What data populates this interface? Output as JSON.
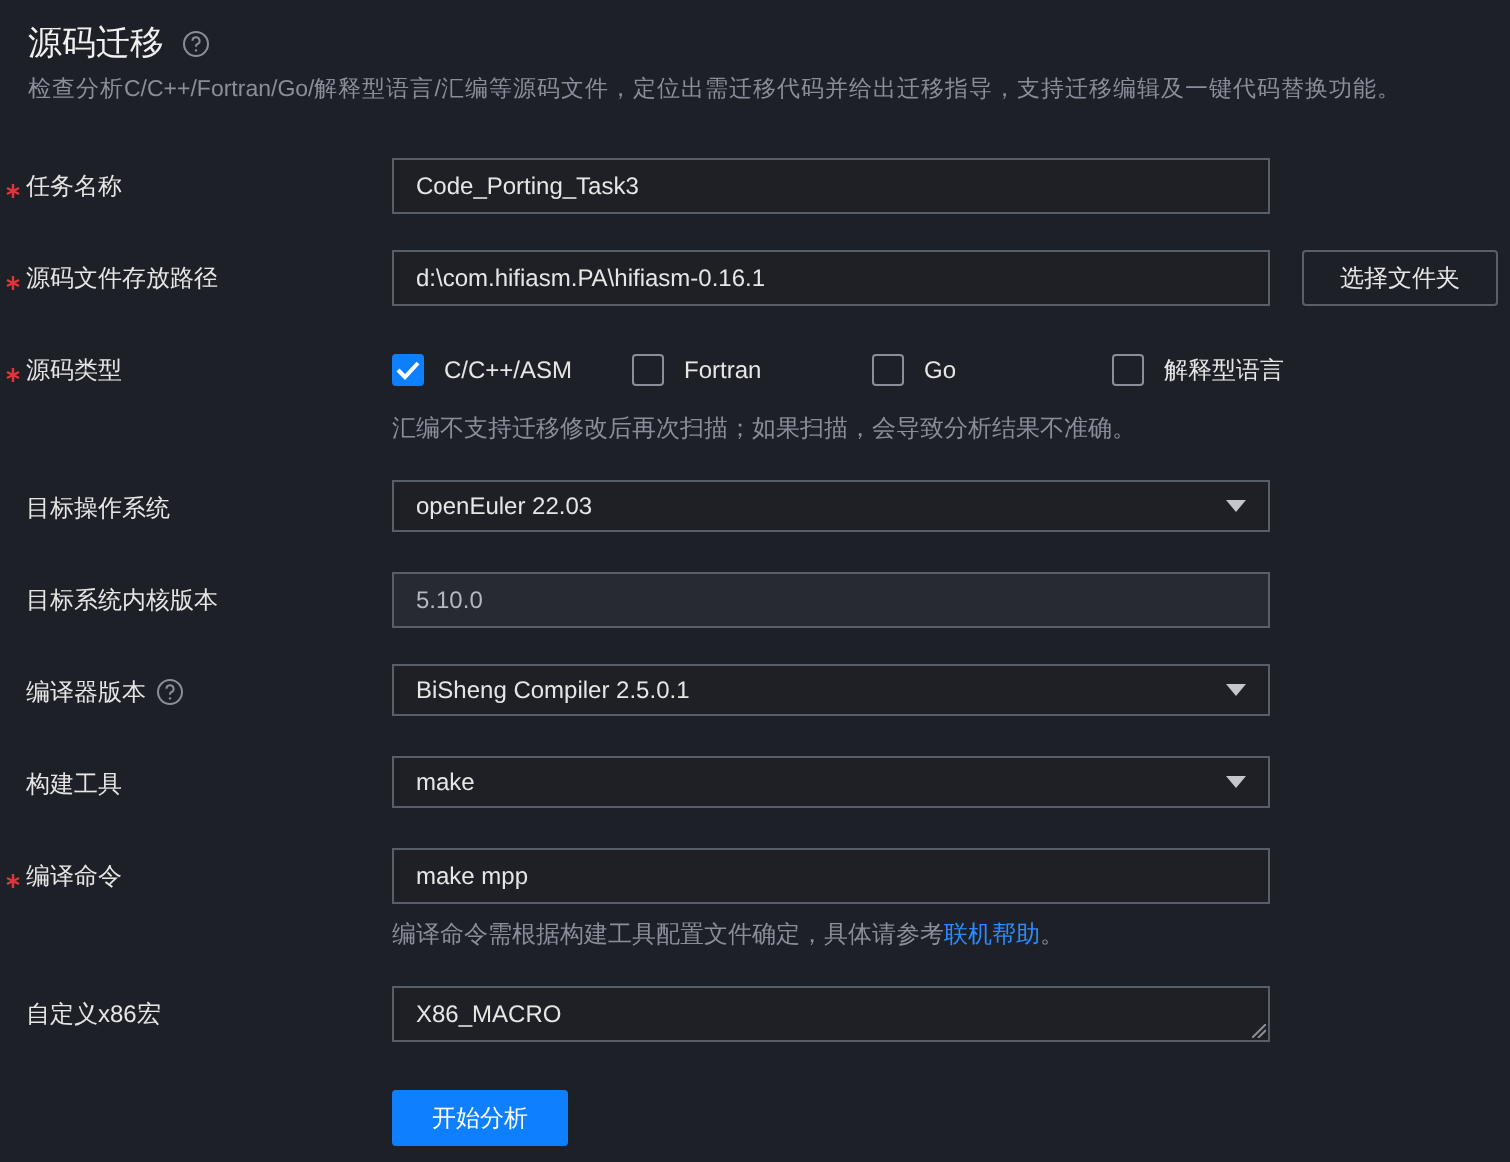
{
  "header": {
    "title": "源码迁移",
    "description": "检查分析C/C++/Fortran/Go/解释型语言/汇编等源码文件，定位出需迁移代码并给出迁移指导，支持迁移编辑及一键代码替换功能。"
  },
  "fields": [
    {
      "kind": "text",
      "label": "任务名称",
      "required": true,
      "value": "Code_Porting_Task3"
    },
    {
      "kind": "path",
      "label": "源码文件存放路径",
      "required": true,
      "value": "d:\\com.hifiasm.PA\\hifiasm-0.16.1",
      "button": "选择文件夹"
    },
    {
      "kind": "checkboxes",
      "label": "源码类型",
      "required": true,
      "options": [
        {
          "label": "C/C++/ASM",
          "checked": true
        },
        {
          "label": "Fortran",
          "checked": false
        },
        {
          "label": "Go",
          "checked": false
        },
        {
          "label": "解释型语言",
          "checked": false
        }
      ],
      "hint": "汇编不支持迁移修改后再次扫描；如果扫描，会导致分析结果不准确。"
    },
    {
      "kind": "select",
      "label": "目标操作系统",
      "required": false,
      "value": "openEuler 22.03"
    },
    {
      "kind": "disabled",
      "label": "目标系统内核版本",
      "required": false,
      "value": "5.10.0"
    },
    {
      "kind": "select",
      "label": "编译器版本",
      "required": false,
      "help": true,
      "value": "BiSheng Compiler 2.5.0.1"
    },
    {
      "kind": "select",
      "label": "构建工具",
      "required": false,
      "value": "make"
    },
    {
      "kind": "text",
      "label": "编译命令",
      "required": true,
      "value": "make mpp",
      "hint": "编译命令需根据构建工具配置文件确定，具体请参考",
      "link": "联机帮助",
      "hint_end": "。"
    },
    {
      "kind": "textarea",
      "label": "自定义x86宏",
      "required": false,
      "value": "X86_MACRO"
    }
  ],
  "submit": "开始分析"
}
